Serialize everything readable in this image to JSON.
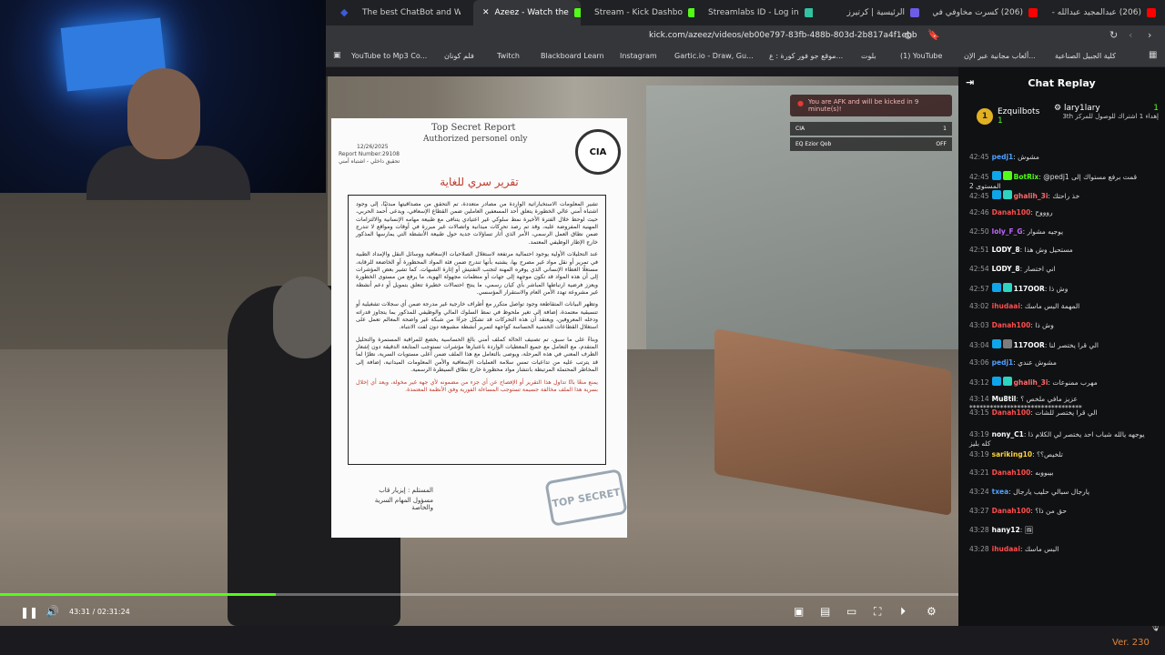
{
  "browser": {
    "tabs": [
      {
        "label": "The best ChatBot and Wi...",
        "color": "#3b5bdb"
      },
      {
        "label": "Azeez - Watch the",
        "color": "#53fc18",
        "active": true
      },
      {
        "label": "Stream - Kick Dashbo",
        "color": "#53fc18"
      },
      {
        "label": "Streamlabs ID - Log in",
        "color": "#31c3a2"
      },
      {
        "label": "الرئيسية | كرتيرز",
        "color": "#6c5ce7"
      },
      {
        "label": "(206) كسرت مخاوفي في الح",
        "color": "#ff0000"
      },
      {
        "label": "(206) عبدالمجيد عبدالله - عا",
        "color": "#ff0000"
      }
    ],
    "url": "kick.com/azeez/videos/eb00e797-83fb-488b-803d-2b817a4f1ebb",
    "bookmarks": [
      "YouTube to Mp3 Co...",
      "فلم كونان",
      "Twitch",
      "Blackboard Learn",
      "Instagram",
      "Gartic.io - Draw, Gu...",
      "موقع جو فور كورة : ع...",
      "بلوت",
      "(1) YouTube",
      "ألعاب مجانية عبر الإن...",
      "كلية الجبيل الصناعية"
    ]
  },
  "hud": {
    "afk_text": "You are AFK and will be kicked in 9 minute(s)!",
    "rows": [
      {
        "left": "CIA",
        "right": "1"
      },
      {
        "left": "EQ      Ezior Qob",
        "right": "OFF"
      }
    ]
  },
  "document": {
    "title": "Top Secret Report",
    "subtitle": "Authorized personel only",
    "date": "12/26/2025",
    "report_number": "Report Number:29108",
    "classification": "تحقيق داخلي - اشتباه أمني",
    "heading": "تقرير سري للغاية",
    "paragraphs": [
      "تشير المعلومات الاستخباراتية الواردة من مصادر متعددة، تم التحقق من مصداقيتها مبدئيًا، إلى وجود اشتباه أمني عالي الخطورة يتعلق أحد المسعفين العاملين ضمن القطاع الإسعافي، ويدعى أحمد الحربي، حيث لوحظ خلال الفترة الأخيرة نمط سلوكي غير اعتيادي يتنافى مع طبيعة مهامه الإنسانية والالتزامات المهنية المفروضة عليه، وقد تم رصد تحركات ميدانية واتصالات غير مبررة في أوقات ومواقع لا تندرج ضمن نطاق العمل الرسمي، الأمر الذي أثار تساؤلات جدية حول طبيعة الأنشطة التي يمارسها المذكور خارج الإطار الوظيفي المعتمد.",
      "عند التحليلات الأولية يوجود احتمالية مرتفعة لاستغلال الصلاحيات الإسعافية ووسائل النقل والإمداد الطبية في تمرير أو نقل مواد غير مصرح بها، يشتبه بأنها تندرج ضمن فئة المواد المحظورة أو الخاضعة للرقابة، مستغلًا الغطاء الإنساني الذي يوفره المهنة لتجنب التفتيش أو إثارة الشبهات. كما تشير بعض المؤشرات إلى أن هذه المواد قد تكون موجهة إلى جهات أو منظمات مجهولة الهوية، ما يرفع من مستوى الخطورة ويعزز فرضية ارتباطها المباشر بأي كيان رسمي، ما ينتج احتمالات خطيرة تتعلق بتمويل أو دعم أنشطة غير مشروعة تهدد الأمن العام والاستقرار المؤسسي.",
      "وتظهر البيانات المتقاطعة وجود تواصل متكرر مع أطراف خارجية غير مدرجة ضمن أي سجلات تشغيلية أو تنسيقية معتمدة، إضافة إلى تغير ملحوظ في نمط السلوك المالي والوظيفي للمذكور بما يتجاوز قدراته ودخله المعروفين، ويعتقد أن هذه التحركات قد تشكل جزءًا من شبكة غير واضحة المعالم تعمل على استغلال القطاعات الخدمية الحساسة كواجهة لتمرير أنشطة مشبوهة دون لفت الانتباه.",
      "وبناءً على ما سبق، تم تصنيف الحالة كملف أمني بالغ الحساسية يخضع للمراقبة المستمرة والتحليل المتقدم، مع التعامل مع جميع المعطيات الواردة باعتبارها مؤشرات تستوجب المتابعة الدقيقة دون إشعار الطرف المعني في هذه المرحلة، ويوصى بالتعامل مع هذا الملف ضمن أعلى مستويات السرية، نظرًا لما قد يترتب عليه من تداعيات تمس سلامة العمليات الإسعافية والأمن المعلومات الميدانية، إضافة إلى المخاطر المحتملة المرتبطة بانتشار مواد محظورة خارج نطاق السيطرة الرسمية."
    ],
    "warning": "يمنع منعًا باتًا تداول هذا التقرير أو الإفصاح عن أي جزء من مضمونه لأي جهة غير مخولة، ويعد أي إخلال بسرية هذا الملف مخالفة جسيمة تستوجب المساءلة الفورية وفق الأنظمة المعتمدة.",
    "signature_line1": "المستلم : إيزيار قاب",
    "signature_line2": "مسؤول المهام السرية والخاصة",
    "stamp": "TOP SECRET",
    "seal": "CIA"
  },
  "player": {
    "current_time": "43:31",
    "duration": "02:31:24",
    "time_display": "43:31 / 02:31:24",
    "progress_fraction": 0.288
  },
  "chat": {
    "title": "Chat Replay",
    "pinned": {
      "left_user": "Ezquilbots",
      "left_count": "1",
      "right_user": "lary1lary",
      "right_count": "1",
      "right_text": "إهداء 1 اشتراك للوصول للمركز 3th"
    },
    "messages": [
      {
        "time": "42:45",
        "user": "pedj1",
        "color": "#4ea1ff",
        "text": "مشوش"
      },
      {
        "time": "42:45",
        "user": "BotRix",
        "color": "#53fc18",
        "text": "@pedj1 قمت برفع مستواك إلى المستوى 2",
        "badges": [
          "#0ea5e9",
          "#53fc18"
        ]
      },
      {
        "time": "42:45",
        "user": "ghalih_3i",
        "color": "#ff6b6b",
        "text": "خذ راحتك",
        "badges": [
          "#0ea5e9",
          "#2dd4bf"
        ]
      },
      {
        "time": "42:46",
        "user": "Danah100",
        "color": "#ff4d4d",
        "text": "روووح"
      },
      {
        "time": "42:50",
        "user": "loly_F_G",
        "color": "#c266ff",
        "text": "يوجيه مشوار"
      },
      {
        "time": "42:51",
        "user": "LODY_8",
        "color": "#ffffff",
        "text": "مستحيل وش هذا"
      },
      {
        "time": "42:54",
        "user": "LODY_8",
        "color": "#ffffff",
        "text": "اني اختصار"
      },
      {
        "time": "42:57",
        "user": "117OOR",
        "color": "#ffffff",
        "text": "وش ذا",
        "badges": [
          "#0ea5e9",
          "#2dd4bf"
        ]
      },
      {
        "time": "43:02",
        "user": "ihudaai",
        "color": "#ff4d4d",
        "text": "المهمة البس ماسك"
      },
      {
        "time": "43:03",
        "user": "Danah100",
        "color": "#ff4d4d",
        "text": "وش ذا"
      },
      {
        "time": "43:04",
        "user": "117OOR",
        "color": "#ffffff",
        "text": "الي قرا يختصر لنا",
        "badges": [
          "#0ea5e9",
          "#7c7c7c"
        ]
      },
      {
        "time": "43:06",
        "user": "pedj1",
        "color": "#4ea1ff",
        "text": "مشوش عندي"
      },
      {
        "time": "43:12",
        "user": "ghalih_3i",
        "color": "#ff6b6b",
        "text": "مهرب ممنوعات",
        "badges": [
          "#0ea5e9",
          "#2dd4bf"
        ]
      },
      {
        "time": "43:14",
        "user": "Mu8til",
        "color": "#ffffff",
        "text": "عزيز مافي ملخص ؟ *********************************"
      },
      {
        "time": "43:15",
        "user": "Danah100",
        "color": "#ff4d4d",
        "text": "الي قرا يختصر للشات"
      },
      {
        "time": "43:19",
        "user": "nony_C1",
        "color": "#ffffff",
        "text": "يوجهه يالله شباب احد يختصر لي الكلام ذا كله بليز"
      },
      {
        "time": "43:19",
        "user": "sariking10",
        "color": "#ffd43b",
        "text": "تلخيص؟؟"
      },
      {
        "time": "43:21",
        "user": "Danah100",
        "color": "#ff4d4d",
        "text": "بيبووبه"
      },
      {
        "time": "43:24",
        "user": "txea",
        "color": "#4ea1ff",
        "text": "يارجال سبالي حليب يارجال"
      },
      {
        "time": "43:27",
        "user": "Danah100",
        "color": "#ff4d4d",
        "text": "حق من ذا؟"
      },
      {
        "time": "43:28",
        "user": "hany12",
        "color": "#ffffff",
        "text": "🖼"
      },
      {
        "time": "43:28",
        "user": "ihudaai",
        "color": "#ff4d4d",
        "text": "البس ماسك"
      }
    ]
  },
  "footer": {
    "version": "Ver. 230"
  }
}
